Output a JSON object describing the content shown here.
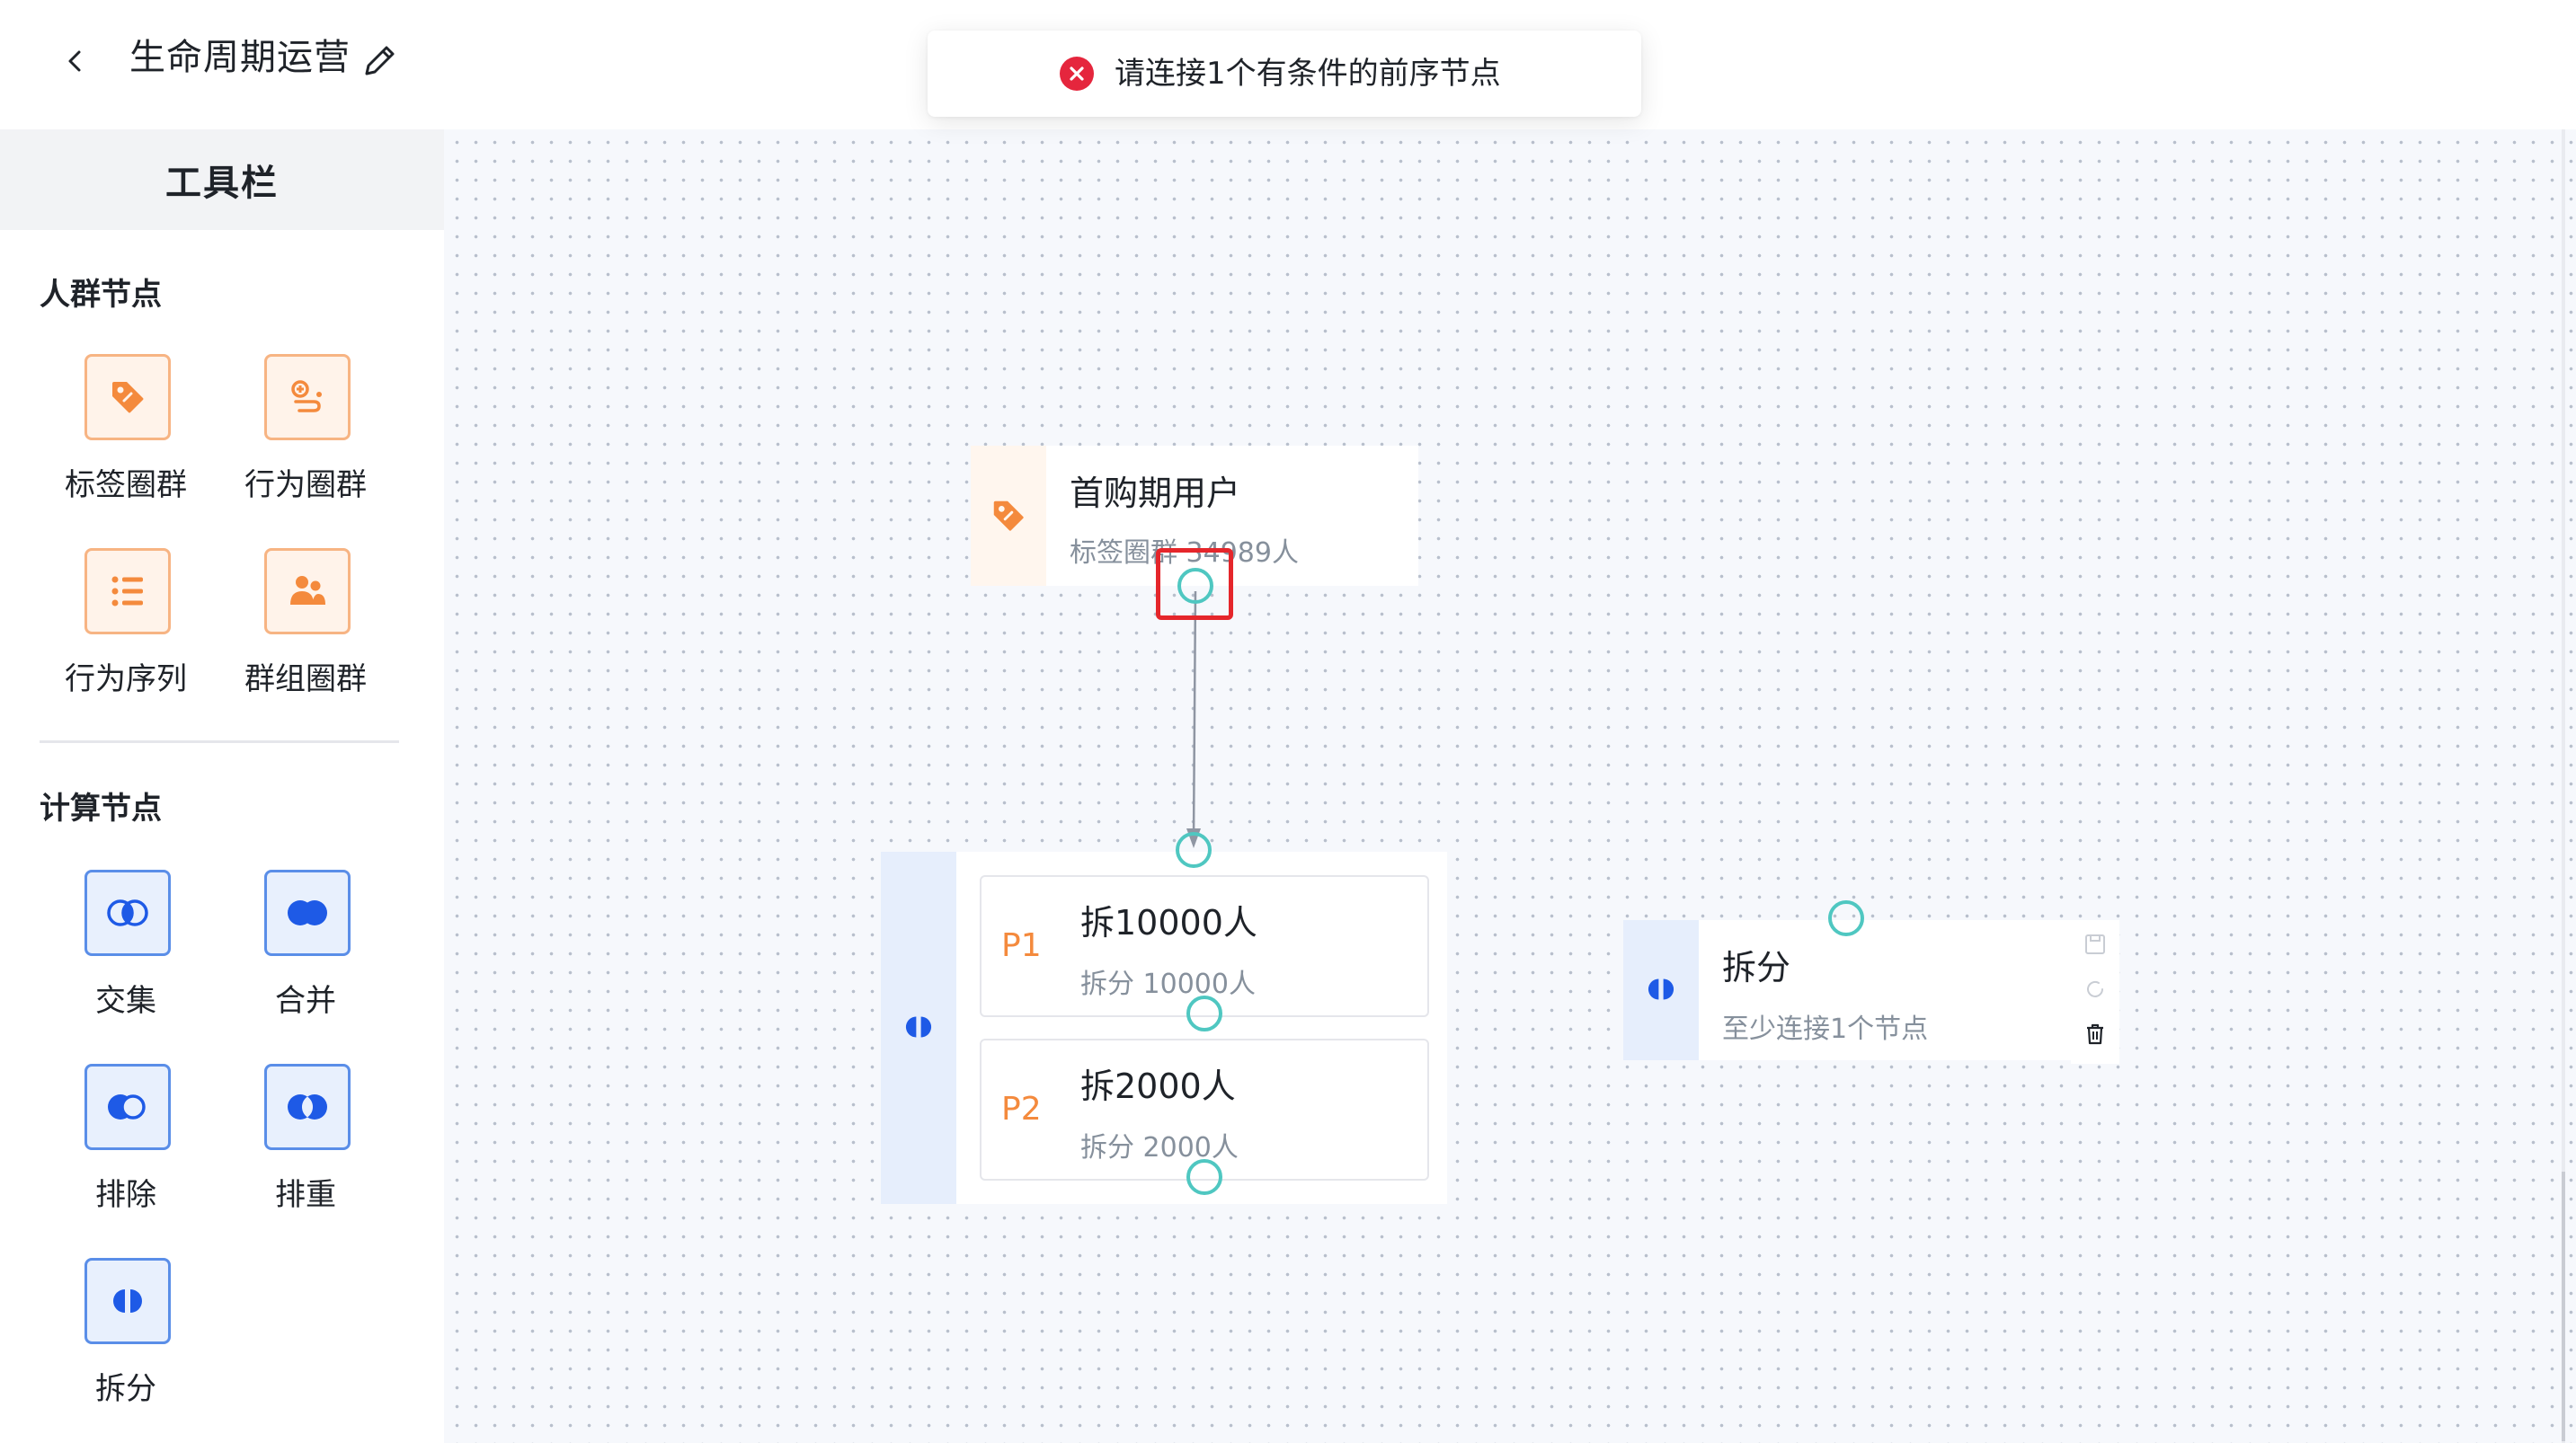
{
  "header": {
    "title": "生命周期运营"
  },
  "toast": {
    "message": "请连接1个有条件的前序节点",
    "status_color": "#e5263d"
  },
  "sidebar": {
    "title": "工具栏",
    "audience_section": {
      "title": "人群节点",
      "tools": [
        {
          "label": "标签圈群",
          "icon": "tag-icon"
        },
        {
          "label": "行为圈群",
          "icon": "behavior-icon"
        },
        {
          "label": "行为序列",
          "icon": "list-icon"
        },
        {
          "label": "群组圈群",
          "icon": "group-icon"
        }
      ]
    },
    "compute_section": {
      "title": "计算节点",
      "tools": [
        {
          "label": "交集",
          "icon": "intersect-icon"
        },
        {
          "label": "合并",
          "icon": "union-icon"
        },
        {
          "label": "排除",
          "icon": "exclude-icon"
        },
        {
          "label": "排重",
          "icon": "dedupe-icon"
        },
        {
          "label": "拆分",
          "icon": "split-icon"
        }
      ]
    }
  },
  "canvas": {
    "source_node": {
      "title": "首购期用户",
      "subtitle": "标签圈群 34989人",
      "icon": "tag-icon"
    },
    "split_node": {
      "icon": "split-icon",
      "branches": [
        {
          "tag": "P1",
          "title": "拆10000人",
          "subtitle": "拆分 10000人"
        },
        {
          "tag": "P2",
          "title": "拆2000人",
          "subtitle": "拆分 2000人"
        }
      ]
    },
    "new_split_node": {
      "title": "拆分",
      "subtitle": "至少连接1个节点",
      "icon": "split-icon",
      "actions": [
        "save-icon",
        "refresh-icon",
        "delete-icon"
      ]
    }
  },
  "colors": {
    "orange_accent": "#f48a3d",
    "blue_accent": "#1e5ae6",
    "port": "#4fc7c1",
    "highlight": "#e5262b"
  }
}
